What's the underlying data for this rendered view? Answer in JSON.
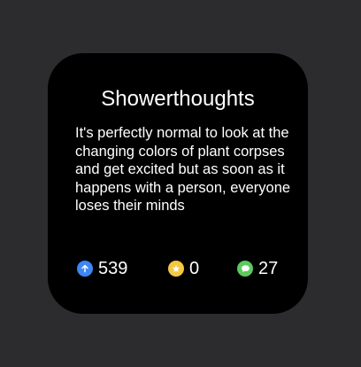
{
  "widget": {
    "title": "Showerthoughts",
    "post_text": "It's perfectly normal to look at the changing colors of plant corpses and get excited but as soon as it happens with a person, everyone loses their minds",
    "stats": {
      "upvotes": {
        "icon": "arrow-up-icon",
        "color": "#3d86f5",
        "count": "539"
      },
      "awards": {
        "icon": "star-icon",
        "color": "#f5c842",
        "count": "0"
      },
      "comments": {
        "icon": "speech-bubble-icon",
        "color": "#5cc95c",
        "count": "27"
      }
    }
  }
}
